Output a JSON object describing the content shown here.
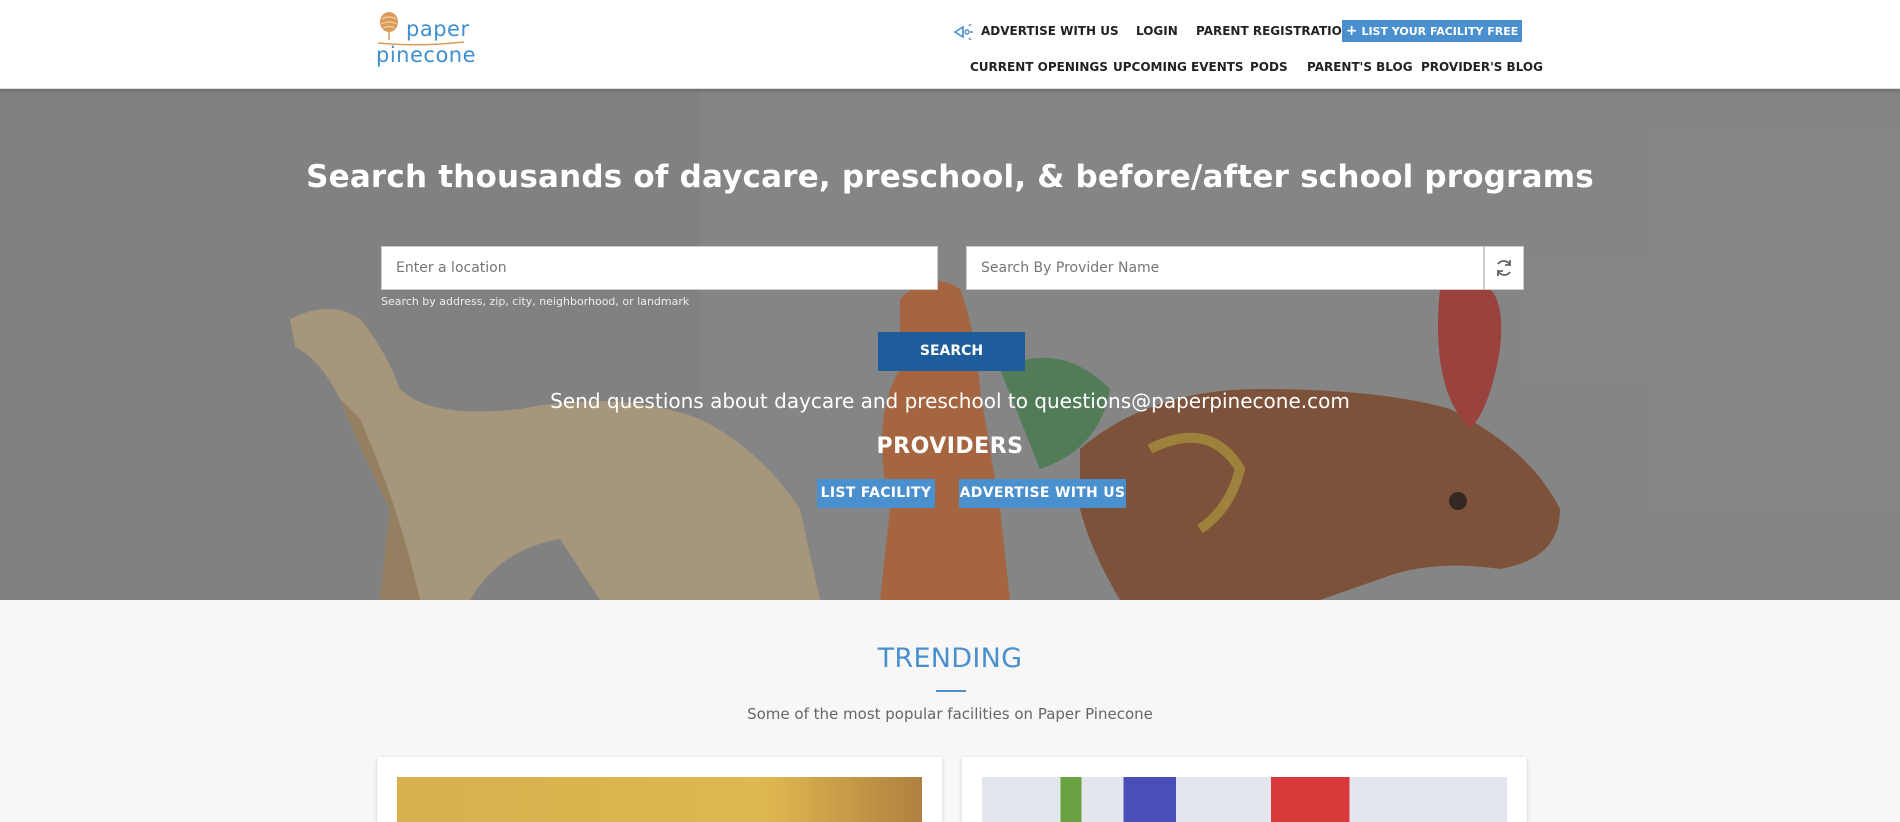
{
  "header": {
    "logo": {
      "line1": "paper",
      "line2": "pinecone"
    },
    "top_nav": {
      "advertise": "ADVERTISE WITH US",
      "login": "LOGIN",
      "parent_registration": "PARENT REGISTRATION",
      "list_facility": "LIST YOUR FACILITY FREE"
    },
    "sub_nav": {
      "current_openings": "CURRENT OPENINGS",
      "upcoming_events": "UPCOMING EVENTS",
      "pods": "PODS",
      "parents_blog": "PARENT'S BLOG",
      "providers_blog": "PROVIDER'S BLOG"
    }
  },
  "hero": {
    "title": "Search thousands of daycare, preschool, & before/after school programs",
    "location_placeholder": "Enter a location",
    "location_hint": "Search by address, zip, city, neighborhood, or landmark",
    "provider_placeholder": "Search By Provider Name",
    "search_label": "SEARCH",
    "questions_text": "Send questions about daycare and preschool to questions@paperpinecone.com",
    "providers_heading": "PROVIDERS",
    "list_facility_label": "LIST FACILITY",
    "advertise_label": "ADVERTISE WITH US"
  },
  "trending": {
    "title": "TRENDING",
    "subtitle": "Some of the most popular facilities on Paper Pinecone"
  },
  "colors": {
    "accent": "#4a90cf",
    "search_button": "#1e5d9b",
    "logo_orange": "#d99a5a"
  },
  "icons": {
    "advertise": "megaphone-icon",
    "refresh": "refresh-icon",
    "plus": "plus-icon"
  }
}
